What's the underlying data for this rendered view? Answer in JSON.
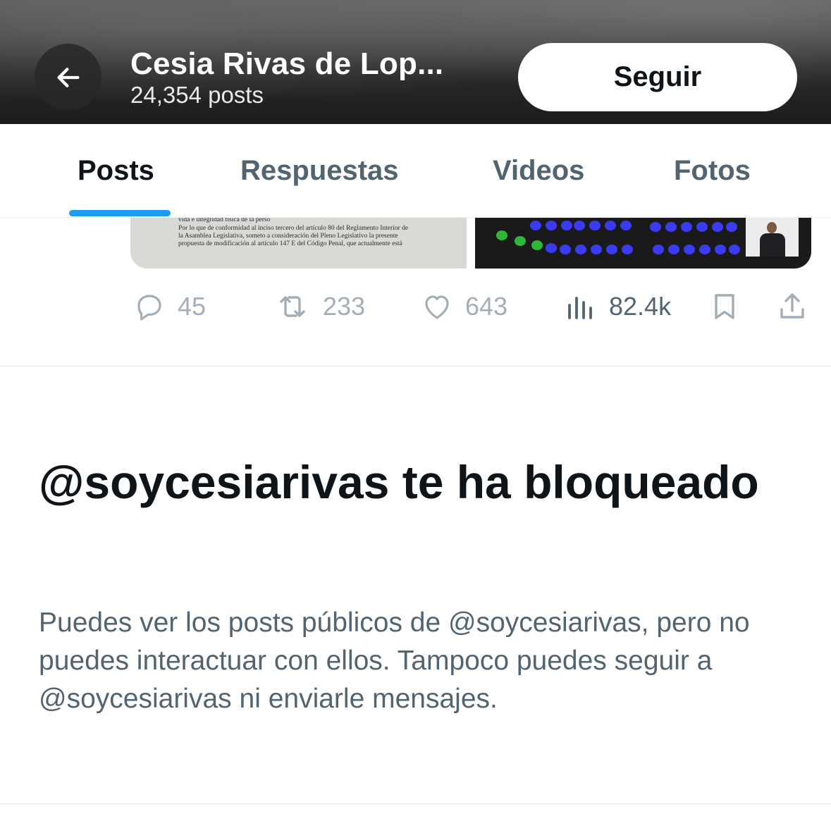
{
  "header": {
    "title": "Cesia Rivas de Lop...",
    "subtitle": "24,354 posts",
    "follow_label": "Seguir"
  },
  "tabs": [
    {
      "label": "Posts",
      "active": true
    },
    {
      "label": "Respuestas",
      "active": false
    },
    {
      "label": "Videos",
      "active": false
    },
    {
      "label": "Fotos",
      "active": false
    }
  ],
  "post": {
    "document_lines": [
      "vida e integridad física de la perso",
      "Por lo que de conformidad al inciso tercero del artículo 80 del Reglamento Interior de",
      "la Asamblea Legislativa, someto a consideración del Pleno Legislativo la presente",
      "propuesta de modificación al artículo 147 E del Código Penal, que actualmente está"
    ],
    "actions": {
      "replies": "45",
      "reposts": "233",
      "likes": "643",
      "views": "82.4k"
    }
  },
  "blocked": {
    "title": "@soycesiarivas te ha bloqueado",
    "description": "Puedes ver los posts públicos de @soycesiarivas, pero no puedes interactuar con ellos. Tampoco puedes seguir a @soycesiarivas ni enviarle mensajes."
  },
  "colors": {
    "accent": "#1d9bf0",
    "text_primary": "#0f1419",
    "text_secondary": "#536471"
  },
  "icons": [
    "back-arrow-icon",
    "reply-icon",
    "repost-icon",
    "like-icon",
    "views-icon",
    "bookmark-icon",
    "share-icon"
  ]
}
